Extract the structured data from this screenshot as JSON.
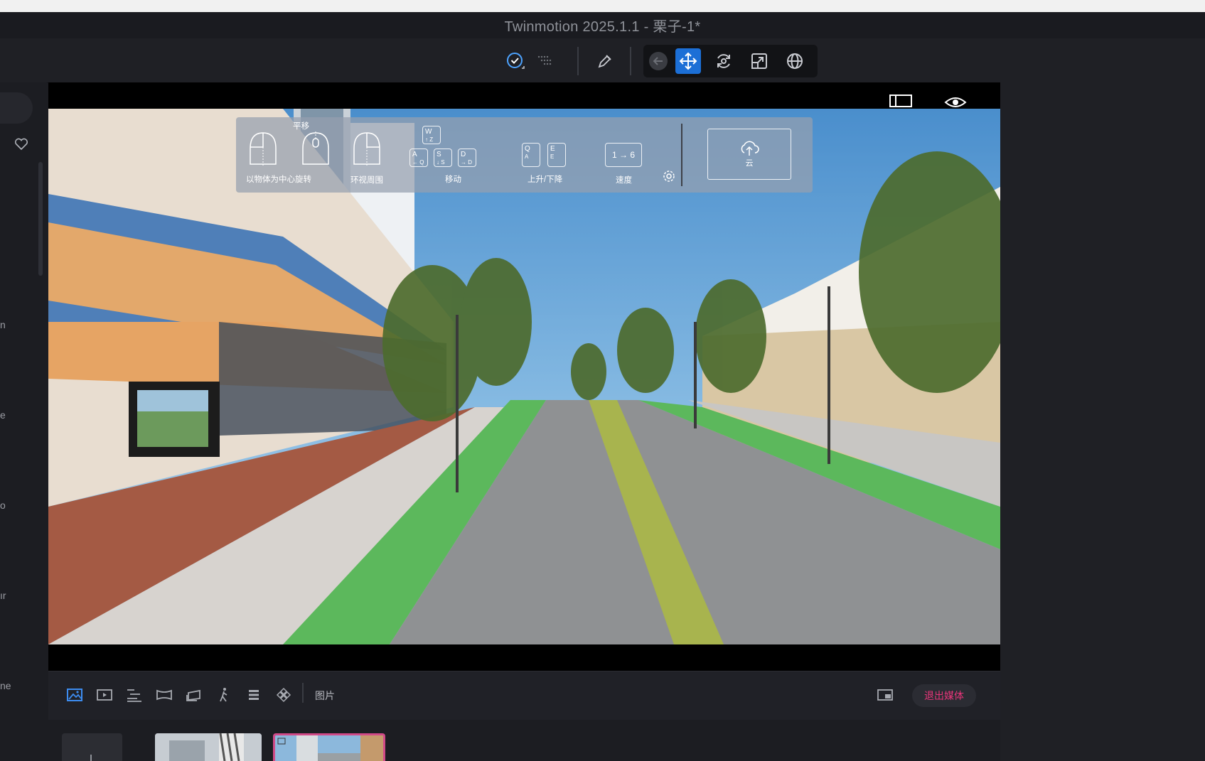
{
  "window": {
    "title": "Twinmotion 2025.1.1 - 栗子-1*"
  },
  "toolbar": {
    "icons": [
      "check-circle-icon",
      "dots-grid-icon",
      "eyedropper-icon",
      "back-arrow-icon",
      "move-icon",
      "rotate-icon",
      "scale-icon",
      "globe-icon"
    ],
    "active": "move-icon",
    "accent": "#1c6fd6"
  },
  "left_panel": {
    "labels": [
      "n",
      "e",
      "o",
      "ır",
      "ne"
    ]
  },
  "navigation_help": {
    "pan_label": "平移",
    "orbit_object_label": "以物体为中心旋转",
    "look_around_label": "环视周围",
    "move_label": "移动",
    "updown_label": "上升/下降",
    "speed_label": "速度",
    "cloud_label": "云",
    "keys": {
      "w": "W",
      "w_sub": "↑ Z",
      "a": "A",
      "a_sub": "← Q",
      "s": "S",
      "s_sub": "↓ S",
      "d": "D",
      "d_sub": "→ D",
      "q": "Q",
      "q_sub": "A",
      "e": "E",
      "e_sub": "E",
      "speed": "1 → 6"
    }
  },
  "media_bar": {
    "section_label": "图片",
    "exit_label": "退出媒体",
    "exit_color": "#e8357a",
    "icons": [
      "image-icon",
      "video-icon",
      "sequence-icon",
      "panorama-icon",
      "presentation-icon",
      "phasing-icon",
      "batch-icon",
      "vr-icon"
    ],
    "active": "image-icon"
  },
  "thumbnails": {
    "count": 2,
    "selected_index": 1
  }
}
